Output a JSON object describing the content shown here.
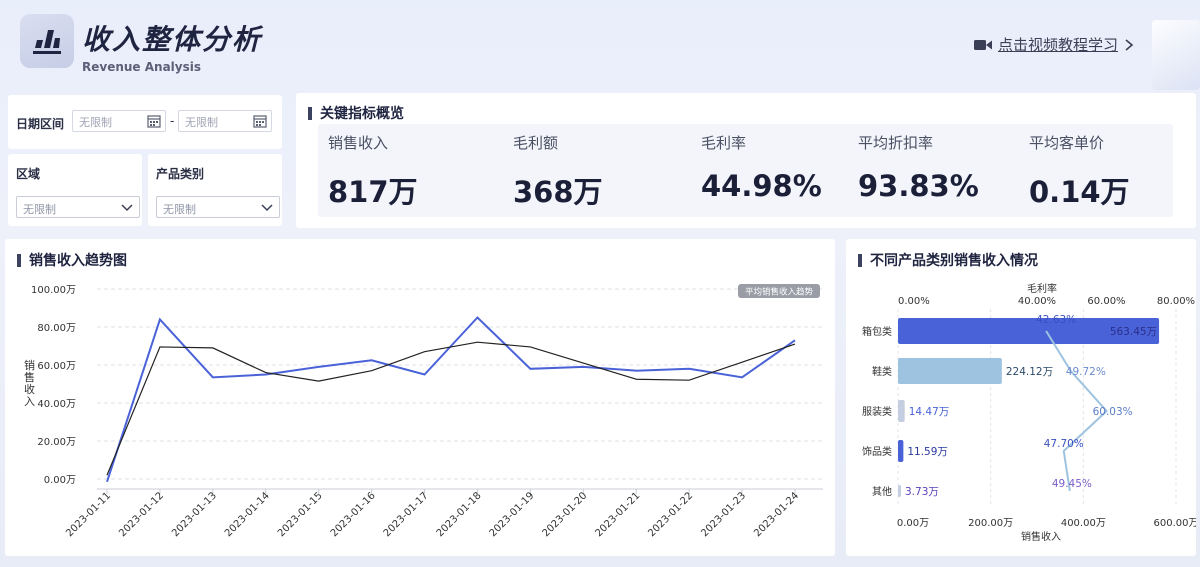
{
  "header": {
    "title": "收入整体分析",
    "subtitle": "Revenue Analysis",
    "video_link": "点击视频教程学习"
  },
  "filters": {
    "date_label": "日期区间",
    "date_start_placeholder": "无限制",
    "date_separator": "-",
    "date_end_placeholder": "无限制",
    "region_label": "区域",
    "region_value": "无限制",
    "category_label": "产品类别",
    "category_value": "无限制"
  },
  "kpis": {
    "title": "关键指标概览",
    "items": [
      {
        "label": "销售收入",
        "value": "817万"
      },
      {
        "label": "毛利额",
        "value": "368万"
      },
      {
        "label": "毛利率",
        "value": "44.98%"
      },
      {
        "label": "平均折扣率",
        "value": "93.83%"
      },
      {
        "label": "平均客单价",
        "value": "0.14万"
      }
    ]
  },
  "trend_chart": {
    "title": "销售收入趋势图",
    "legend_badge": "平均销售收入趋势",
    "colors": {
      "series": "#4a62d8",
      "trend": "#222222",
      "grid": "#dfe2ea"
    }
  },
  "category_chart": {
    "title": "不同产品类别销售收入情况",
    "colors": {
      "bar_dark": "#4a62d8",
      "bar_light": "#9ec3e0",
      "bar_pale": "#c5cde0",
      "line": "#9ec3e0"
    }
  },
  "chart_data": [
    {
      "type": "line",
      "title": "销售收入趋势图",
      "ylabel": "销售收入",
      "xlabel": "",
      "ylim": [
        0,
        100
      ],
      "y_ticks": [
        "0.00万",
        "20.00万",
        "40.00万",
        "60.00万",
        "80.00万",
        "100.00万"
      ],
      "x": [
        "2023-01-11",
        "2023-01-12",
        "2023-01-13",
        "2023-01-14",
        "2023-01-15",
        "2023-01-16",
        "2023-01-17",
        "2023-01-18",
        "2023-01-19",
        "2023-01-20",
        "2023-01-21",
        "2023-01-22",
        "2023-01-23",
        "2023-01-24"
      ],
      "series": [
        {
          "name": "销售收入",
          "values": [
            -1.5,
            84,
            53.5,
            55,
            59,
            62.5,
            55,
            85,
            58,
            59,
            57,
            58,
            53.5,
            73
          ]
        },
        {
          "name": "平均销售收入趋势",
          "values": [
            2,
            69.5,
            69,
            56,
            51.5,
            57,
            67,
            72,
            69.5,
            61,
            52.5,
            52,
            61.5,
            71
          ]
        }
      ]
    },
    {
      "type": "bar",
      "orientation": "horizontal",
      "title": "不同产品类别销售收入情况",
      "categories": [
        "箱包类",
        "鞋类",
        "服装类",
        "饰品类",
        "其他"
      ],
      "series": [
        {
          "name": "销售收入",
          "values": [
            563.45,
            224.12,
            14.47,
            11.59,
            3.73
          ],
          "labels": [
            "563.45万",
            "224.12万",
            "14.47万",
            "11.59万",
            "3.73万"
          ]
        },
        {
          "name": "毛利率",
          "values": [
            42.63,
            49.72,
            60.03,
            47.7,
            49.45
          ],
          "labels": [
            "42.63%",
            "49.72%",
            "60.03%",
            "47.70%",
            "49.45%"
          ]
        }
      ],
      "xlabel": "销售收入",
      "xlim": [
        0,
        600
      ],
      "x_ticks": [
        "0.00万",
        "200.00万",
        "400.00万",
        "600.00万"
      ],
      "x2label": "毛利率",
      "x2lim": [
        0,
        80
      ],
      "x2_ticks": [
        "0.00%",
        "40.00%",
        "60.00%",
        "80.00%"
      ]
    }
  ]
}
